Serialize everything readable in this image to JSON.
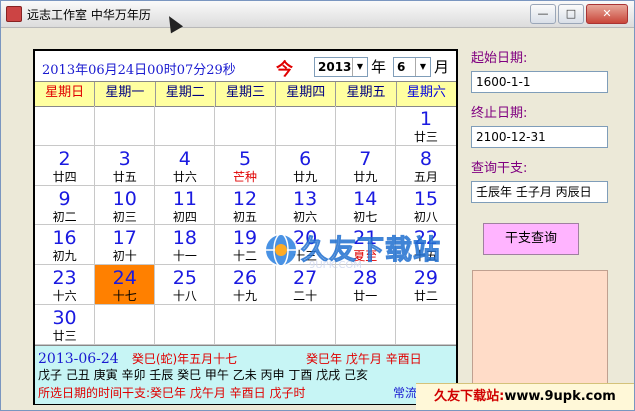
{
  "window": {
    "title": "远志工作室 中华万年历",
    "buttons": {
      "minimize": "—",
      "maximize": "□",
      "close": "✕"
    }
  },
  "header": {
    "datetime": "2013年06月24日00时07分29秒",
    "today_label": "今",
    "year_value": "2013",
    "year_suffix": "年",
    "month_value": "6",
    "month_suffix": "月"
  },
  "weekdays": [
    "星期日",
    "星期一",
    "星期二",
    "星期三",
    "星期四",
    "星期五",
    "星期六"
  ],
  "calendar": {
    "cells": [
      {
        "day": "",
        "lunar": ""
      },
      {
        "day": "",
        "lunar": ""
      },
      {
        "day": "",
        "lunar": ""
      },
      {
        "day": "",
        "lunar": ""
      },
      {
        "day": "",
        "lunar": ""
      },
      {
        "day": "",
        "lunar": ""
      },
      {
        "day": "1",
        "lunar": "廿三"
      },
      {
        "day": "2",
        "lunar": "廿四"
      },
      {
        "day": "3",
        "lunar": "廿五"
      },
      {
        "day": "4",
        "lunar": "廿六"
      },
      {
        "day": "5",
        "lunar": "芒种",
        "term": true
      },
      {
        "day": "6",
        "lunar": "廿九"
      },
      {
        "day": "7",
        "lunar": "廿九"
      },
      {
        "day": "8",
        "lunar": "五月"
      },
      {
        "day": "9",
        "lunar": "初二"
      },
      {
        "day": "10",
        "lunar": "初三"
      },
      {
        "day": "11",
        "lunar": "初四"
      },
      {
        "day": "12",
        "lunar": "初五"
      },
      {
        "day": "13",
        "lunar": "初六"
      },
      {
        "day": "14",
        "lunar": "初七"
      },
      {
        "day": "15",
        "lunar": "初八"
      },
      {
        "day": "16",
        "lunar": "初九"
      },
      {
        "day": "17",
        "lunar": "初十"
      },
      {
        "day": "18",
        "lunar": "十一"
      },
      {
        "day": "19",
        "lunar": "十二"
      },
      {
        "day": "20",
        "lunar": "十三"
      },
      {
        "day": "21",
        "lunar": "夏至",
        "term": true
      },
      {
        "day": "22",
        "lunar": "十五"
      },
      {
        "day": "23",
        "lunar": "十六"
      },
      {
        "day": "24",
        "lunar": "十七",
        "selected": true
      },
      {
        "day": "25",
        "lunar": "十八"
      },
      {
        "day": "26",
        "lunar": "十九"
      },
      {
        "day": "27",
        "lunar": "二十"
      },
      {
        "day": "28",
        "lunar": "廿一"
      },
      {
        "day": "29",
        "lunar": "廿二"
      },
      {
        "day": "30",
        "lunar": "廿三"
      },
      {
        "day": "",
        "lunar": ""
      },
      {
        "day": "",
        "lunar": ""
      },
      {
        "day": "",
        "lunar": ""
      },
      {
        "day": "",
        "lunar": ""
      },
      {
        "day": "",
        "lunar": ""
      },
      {
        "day": "",
        "lunar": ""
      }
    ]
  },
  "info": {
    "date": "2013-06-24",
    "lunar": "癸巳(蛇)年五月十七",
    "ganzhi": "癸巳年 戊午月 辛酉日",
    "hours": "戊子 己丑 庚寅 辛卯 壬辰 癸巳 甲午 乙未 丙申 丁酉 戊戌 己亥",
    "selected_label": "所选日期的时间干支:",
    "selected_ganzhi": "癸巳年 戊午月 辛酉日 戊子时",
    "shichen_label": "常流水"
  },
  "sidebar": {
    "start_label": "起始日期:",
    "start_value": "1600-1-1",
    "end_label": "终止日期:",
    "end_value": "2100-12-31",
    "query_label": "查询干支:",
    "query_value": "壬辰年 壬子月 丙辰日",
    "query_button": "干支查询"
  },
  "watermark": {
    "text": "久友下载站",
    "sub": "9UPK.COM"
  },
  "badge": {
    "prefix": "久友下载站:",
    "site": "www.9upk.com"
  }
}
